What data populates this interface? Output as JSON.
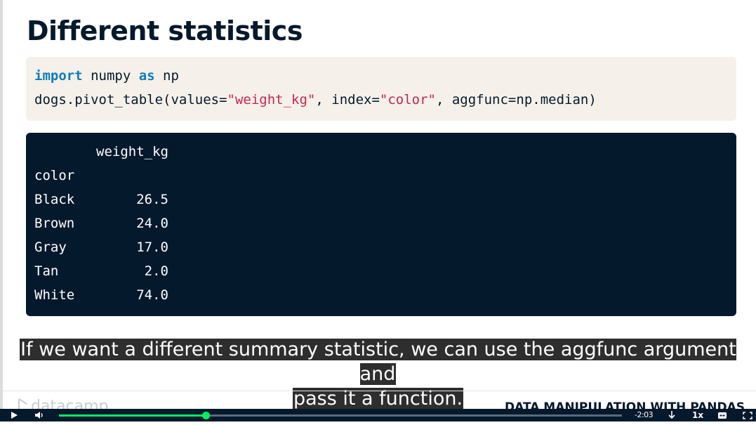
{
  "slide": {
    "title": "Different statistics",
    "code": {
      "line1": {
        "kw1": "import",
        "t1": " numpy ",
        "kw2": "as",
        "t2": " np"
      },
      "line2": {
        "t1": "dogs.pivot_table(values=",
        "s1": "\"weight_kg\"",
        "t2": ", index=",
        "s2": "\"color\"",
        "t3": ", aggfunc=np.median)"
      }
    },
    "output": {
      "column_header": "weight_kg",
      "index_name": "color",
      "rows": [
        {
          "label": "Black",
          "value": "26.5"
        },
        {
          "label": "Brown",
          "value": "24.0"
        },
        {
          "label": "Gray",
          "value": "17.0"
        },
        {
          "label": "Tan",
          "value": "2.0"
        },
        {
          "label": "White",
          "value": "74.0"
        }
      ]
    }
  },
  "caption": {
    "line1": "If we want a different summary statistic, we can use the aggfunc argument and",
    "line2": "pass it a function."
  },
  "footer": {
    "logo_text": "datacamp",
    "course_title": "DATA MANIPULATION WITH PANDAS"
  },
  "player": {
    "time_remaining": "-2:03",
    "speed": "1x",
    "progress": 0.26,
    "accent_color": "#03ef62",
    "icons": [
      "play-icon",
      "volume-icon",
      "download-icon",
      "closed-captions-icon",
      "fullscreen-icon"
    ]
  }
}
